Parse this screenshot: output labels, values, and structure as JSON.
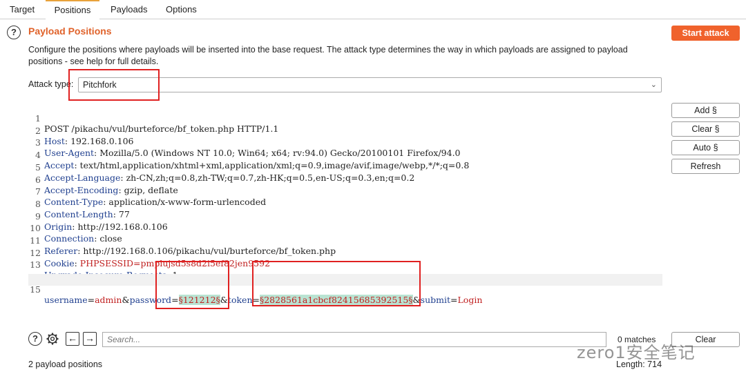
{
  "tabs": [
    {
      "label": "Target"
    },
    {
      "label": "Positions"
    },
    {
      "label": "Payloads"
    },
    {
      "label": "Options"
    }
  ],
  "section": {
    "title": "Payload Positions",
    "description": "Configure the positions where payloads will be inserted into the base request. The attack type determines the way in which payloads are assigned to payload positions - see help for full details.",
    "start_attack_label": "Start attack",
    "help_icon": "?"
  },
  "attack_type": {
    "label": "Attack type:",
    "value": "Pitchfork"
  },
  "side_buttons": {
    "add": "Add §",
    "clear": "Clear §",
    "auto": "Auto §",
    "refresh": "Refresh"
  },
  "request_lines": [
    {
      "n": "1",
      "text": "POST /pikachu/vul/burteforce/bf_token.php HTTP/1.1"
    },
    {
      "n": "2",
      "key": "Host",
      "value": "192.168.0.106"
    },
    {
      "n": "3",
      "key": "User-Agent",
      "value": "Mozilla/5.0 (Windows NT 10.0; Win64; x64; rv:94.0) Gecko/20100101 Firefox/94.0"
    },
    {
      "n": "4",
      "key": "Accept",
      "value": "text/html,application/xhtml+xml,application/xml;q=0.9,image/avif,image/webp,*/*;q=0.8"
    },
    {
      "n": "5",
      "key": "Accept-Language",
      "value": "zh-CN,zh;q=0.8,zh-TW;q=0.7,zh-HK;q=0.5,en-US;q=0.3,en;q=0.2"
    },
    {
      "n": "6",
      "key": "Accept-Encoding",
      "value": "gzip, deflate"
    },
    {
      "n": "7",
      "key": "Content-Type",
      "value": "application/x-www-form-urlencoded"
    },
    {
      "n": "8",
      "key": "Content-Length",
      "value": "77"
    },
    {
      "n": "9",
      "key": "Origin",
      "value": "http://192.168.0.106"
    },
    {
      "n": "10",
      "key": "Connection",
      "value": "close"
    },
    {
      "n": "11",
      "key": "Referer",
      "value": "http://192.168.0.106/pikachu/vul/burteforce/bf_token.php"
    },
    {
      "n": "12",
      "key": "Cookie",
      "value": "PHPSESSID=pmplujsd5s8d2i5ef82jen9592"
    },
    {
      "n": "13",
      "key": "Upgrade-Insecure-Requests",
      "value": "1"
    },
    {
      "n": "14",
      "text": ""
    },
    {
      "n": "15"
    }
  ],
  "body_line": {
    "username_key": "username",
    "eq1": "=",
    "username_val": "admin",
    "amp1": "&",
    "password_key": "password",
    "eq2": "=",
    "password_payload": "§121212§",
    "amp2": "&",
    "token_key": "token",
    "eq3": "=",
    "token_payload": "§2828561a1cbcf82415685392515§",
    "amp3": "&",
    "submit_key": "submit",
    "eq4": "=",
    "submit_val": "Login"
  },
  "search": {
    "placeholder": "Search...",
    "matches": "0 matches",
    "clear_label": "Clear"
  },
  "status": {
    "positions": "2 payload positions",
    "length": "Length: 714"
  },
  "watermark": "zero1安全笔记",
  "colors": {
    "accent": "#f0622c",
    "title": "#e0622a",
    "payload_bg": "#b9e3d2",
    "annotation": "#e02020"
  }
}
